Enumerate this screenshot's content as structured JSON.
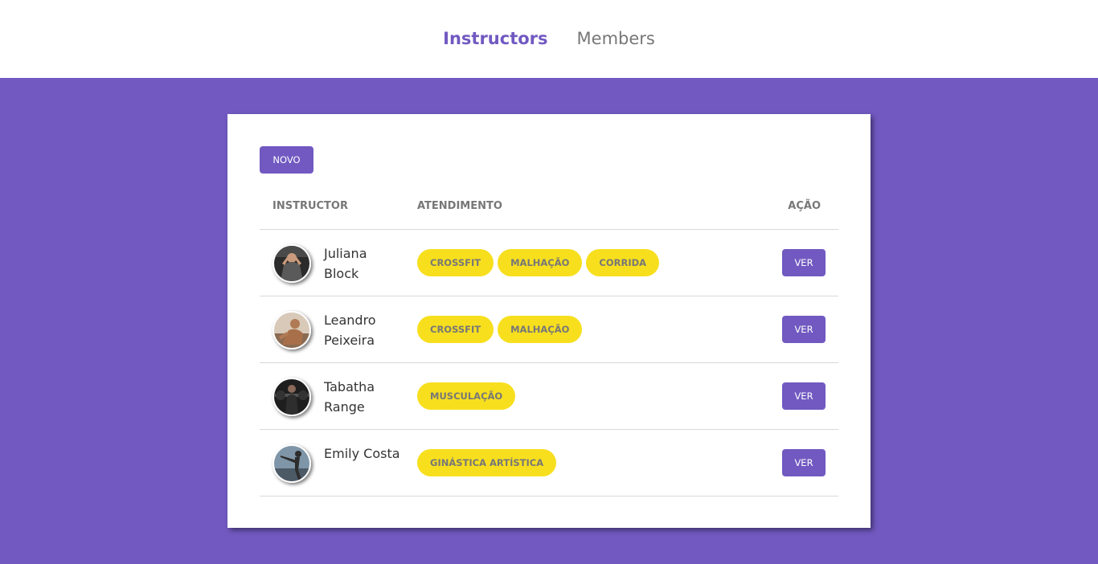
{
  "nav": {
    "items": [
      {
        "label": "Instructors",
        "active": true
      },
      {
        "label": "Members",
        "active": false
      }
    ]
  },
  "colors": {
    "primary": "#7159c1",
    "tag_bg": "#f7df1e",
    "text_muted": "#777777"
  },
  "card": {
    "new_button_label": "NOVO",
    "columns": {
      "instructor": "INSTRUCTOR",
      "services": "ATENDIMENTO",
      "action": "AÇÃO"
    },
    "rows": [
      {
        "name": "Juliana Block",
        "avatar": "avatar-photo",
        "services": [
          "CROSSFIT",
          "MALHAÇÃO",
          "CORRIDA"
        ],
        "action_label": "VER"
      },
      {
        "name": "Leandro Peixeira",
        "avatar": "avatar-photo",
        "services": [
          "CROSSFIT",
          "MALHAÇÃO"
        ],
        "action_label": "VER"
      },
      {
        "name": "Tabatha Range",
        "avatar": "avatar-photo",
        "services": [
          "MUSCULAÇÃO"
        ],
        "action_label": "VER"
      },
      {
        "name": "Emily Costa",
        "avatar": "avatar-photo",
        "services": [
          "GINÁSTICA ARTÍSTICA"
        ],
        "action_label": "VER"
      }
    ]
  }
}
